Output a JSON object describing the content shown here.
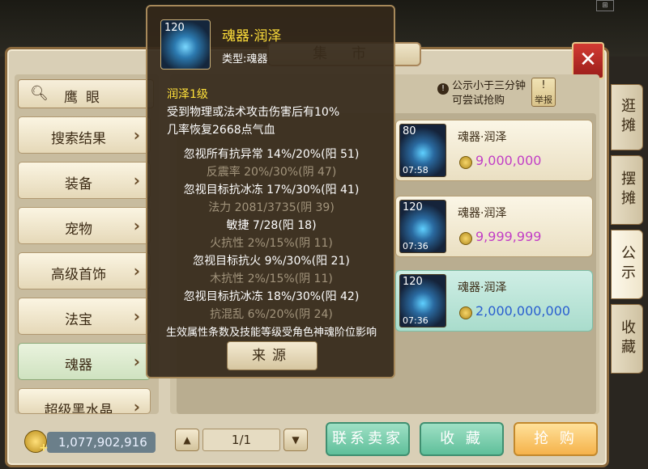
{
  "market_title": "集 市",
  "top_corner_label": "⊞",
  "close_label": "✕",
  "search": {
    "label": "鹰眼"
  },
  "categories": [
    {
      "label": "搜索结果"
    },
    {
      "label": "装备"
    },
    {
      "label": "宠物"
    },
    {
      "label": "高级首饰"
    },
    {
      "label": "法宝"
    },
    {
      "label": "魂器"
    },
    {
      "label": "超级黑水晶"
    }
  ],
  "notice": {
    "text": "公示小于三分钟可尝试抢购",
    "icon": "!"
  },
  "report": {
    "icon": "!",
    "label": "举报"
  },
  "listings": [
    {
      "level": "80",
      "time": "07:58",
      "name": "魂器·润泽",
      "price": "9,000,000"
    },
    {
      "level": "120",
      "time": "07:36",
      "name": "魂器·润泽",
      "price": "9,999,999"
    },
    {
      "level": "120",
      "time": "07:36",
      "name": "魂器·润泽",
      "price": "2,000,000,000"
    }
  ],
  "side_tabs": [
    {
      "label": "逛摊"
    },
    {
      "label": "摆摊"
    },
    {
      "label": "公示"
    },
    {
      "label": "收藏"
    }
  ],
  "money": {
    "amount": "1,077,902,916"
  },
  "pagination": {
    "prev": "▲",
    "next": "▼",
    "page": "1/1"
  },
  "actions": {
    "contact": "联系卖家",
    "favorite": "收 藏",
    "buy": "抢 购"
  },
  "tooltip": {
    "level": "120",
    "name": "魂器·润泽",
    "type": "类型:魂器",
    "skill_name": "润泽1级",
    "skill_desc_1": "受到物理或法术攻击伤害后有10%",
    "skill_desc_2": "几率恢复2668点气血",
    "attrs": [
      {
        "text": "忽视所有抗异常 14%/20%(阳 51)",
        "color": "white"
      },
      {
        "text": "反震率 20%/30%(阴 47)",
        "color": "gray"
      },
      {
        "text": "忽视目标抗冰冻 17%/30%(阳 41)",
        "color": "white"
      },
      {
        "text": "法力 2081/3735(阴 39)",
        "color": "gray"
      },
      {
        "text": "敏捷 7/28(阳 18)",
        "color": "white"
      },
      {
        "text": "火抗性 2%/15%(阴 11)",
        "color": "gray"
      },
      {
        "text": "忽视目标抗火 9%/30%(阳 21)",
        "color": "white"
      },
      {
        "text": "木抗性 2%/15%(阴 11)",
        "color": "gray"
      },
      {
        "text": "忽视目标抗冰冻 18%/30%(阳 42)",
        "color": "white"
      },
      {
        "text": "抗混乱 6%/20%(阴 24)",
        "color": "gray"
      }
    ],
    "footnote": "生效属性条数及技能等级受角色神魂阶位影响",
    "source_button": "来源"
  }
}
